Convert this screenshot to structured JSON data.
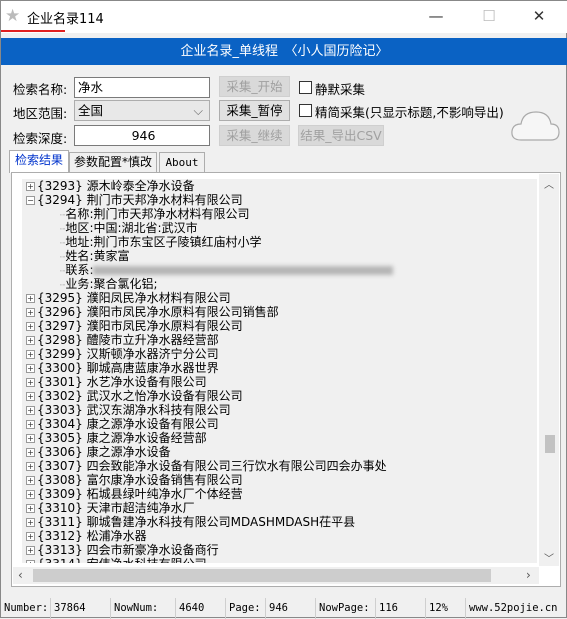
{
  "window": {
    "title": "企业名录114",
    "minimize": "—",
    "maximize": "☐",
    "close": "✕"
  },
  "banner": "企业名录_单线程　〈小人国历险记〉",
  "form": {
    "name_label": "检索名称:",
    "name_value": "净水",
    "region_label": "地区范围:",
    "region_value": "全国",
    "depth_label": "检索深度:",
    "depth_value": "946",
    "start_btn": "采集_开始",
    "pause_btn": "采集_暂停",
    "continue_btn": "采集_继续",
    "export_btn": "结果_导出CSV",
    "silent_label": "静默采集",
    "simple_label": "精简采集(只显示标题,不影响导出)"
  },
  "tabs": [
    "检索结果",
    "参数配置*慎改",
    "About"
  ],
  "tree": {
    "before": [
      {
        "id": "{3293}",
        "name": "源木岭泰全净水设备"
      }
    ],
    "expanded": {
      "id": "{3294}",
      "name": "荆门市天邦净水材料有限公司",
      "details": [
        {
          "k": "名称",
          "v": "荆门市天邦净水材料有限公司"
        },
        {
          "k": "地区",
          "v": "中国:湖北省:武汉市"
        },
        {
          "k": "地址",
          "v": "荆门市东宝区子陵镇红庙村小学"
        },
        {
          "k": "姓名",
          "v": "黄家富"
        },
        {
          "k": "联系",
          "v": ""
        },
        {
          "k": "业务",
          "v": "聚合氯化铝;"
        }
      ]
    },
    "after": [
      {
        "id": "{3295}",
        "name": "濮阳凤民净水材料有限公司"
      },
      {
        "id": "{3296}",
        "name": "濮阳市凤民净水原料有限公司销售部"
      },
      {
        "id": "{3297}",
        "name": "濮阳市凤民净水原料有限公司"
      },
      {
        "id": "{3298}",
        "name": "醴陵市立升净水器经营部"
      },
      {
        "id": "{3299}",
        "name": "汉斯顿净水器济宁分公司"
      },
      {
        "id": "{3300}",
        "name": "聊城高唐蓝康净水器世界"
      },
      {
        "id": "{3301}",
        "name": "水艺净水设备有限公司"
      },
      {
        "id": "{3302}",
        "name": "武汉水之怡净水设备有限公司"
      },
      {
        "id": "{3303}",
        "name": "武汉东湖净水科技有限公司"
      },
      {
        "id": "{3304}",
        "name": "康之源净水设备有限公司"
      },
      {
        "id": "{3305}",
        "name": "康之源净水设备经营部"
      },
      {
        "id": "{3306}",
        "name": "康之源净水设备"
      },
      {
        "id": "{3307}",
        "name": "四会致能净水设备有限公司三行饮水有限公司四会办事处"
      },
      {
        "id": "{3308}",
        "name": "富尔康净水设备销售有限公司"
      },
      {
        "id": "{3309}",
        "name": "柘城县绿叶纯净水厂个体经营"
      },
      {
        "id": "{3310}",
        "name": "天津市超洁纯净水厂"
      },
      {
        "id": "{3311}",
        "name": "聊城鲁建净水科技有限公司MDASHMDASH茌平县"
      },
      {
        "id": "{3312}",
        "name": "松浦净水器"
      },
      {
        "id": "{3313}",
        "name": "四会市新豪净水设备商行"
      },
      {
        "id": "{3314}",
        "name": "宏伟净水科技有限公司"
      }
    ]
  },
  "status": {
    "number_label": "Number:",
    "number": "37864",
    "nownum_label": "NowNum:",
    "nownum": "4640",
    "page_label": "Page:",
    "page": "946",
    "nowpage_label": "NowPage:",
    "nowpage": "116",
    "percent": "12%",
    "site": "www.52pojie.cn"
  },
  "progress_percent": 12,
  "colors": {
    "banner": "#0a62c4",
    "title_underline": "#e02020"
  }
}
